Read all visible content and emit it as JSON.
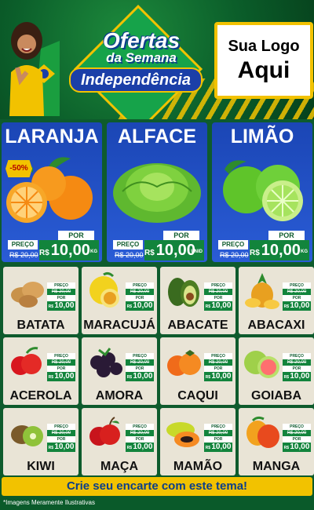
{
  "header": {
    "title_line1": "Ofertas",
    "title_line2": "da Semana",
    "title_line3": "Independência",
    "logo_line1": "Sua Logo",
    "logo_line2": "Aqui"
  },
  "featured": [
    {
      "name": "LARANJA",
      "badge": "-50%",
      "por": "POR",
      "preco": "PREÇO",
      "old": "R$ 20,00",
      "rs": "R$",
      "price": "10,00",
      "unit": "KG"
    },
    {
      "name": "ALFACE",
      "por": "POR",
      "preco": "PREÇO",
      "old": "R$ 20,00",
      "rs": "R$",
      "price": "10,00",
      "unit": "UNID"
    },
    {
      "name": "LIMÃO",
      "por": "POR",
      "preco": "PREÇO",
      "old": "R$ 20,00",
      "rs": "R$",
      "price": "10,00",
      "unit": "KG"
    }
  ],
  "grid": [
    {
      "name": "BATATA"
    },
    {
      "name": "MARACUJÁ"
    },
    {
      "name": "ABACATE"
    },
    {
      "name": "ABACAXI"
    },
    {
      "name": "ACEROLA"
    },
    {
      "name": "AMORA"
    },
    {
      "name": "CAQUI"
    },
    {
      "name": "GOIABA"
    },
    {
      "name": "KIWI"
    },
    {
      "name": "MAÇA"
    },
    {
      "name": "MAMÃO"
    },
    {
      "name": "MANGA"
    }
  ],
  "small_price": {
    "preco": "PREÇO",
    "old": "R$ 20,00",
    "por": "POR",
    "rs": "R$",
    "price": "10,00",
    "unit": "KG"
  },
  "cta": "Crie seu encarte com este tema!",
  "footnote": "*Imagens Meramente Ilustrativas",
  "colors": {
    "green": "#0e5b2d",
    "blue": "#1b46b5",
    "yellow": "#f2c200"
  }
}
